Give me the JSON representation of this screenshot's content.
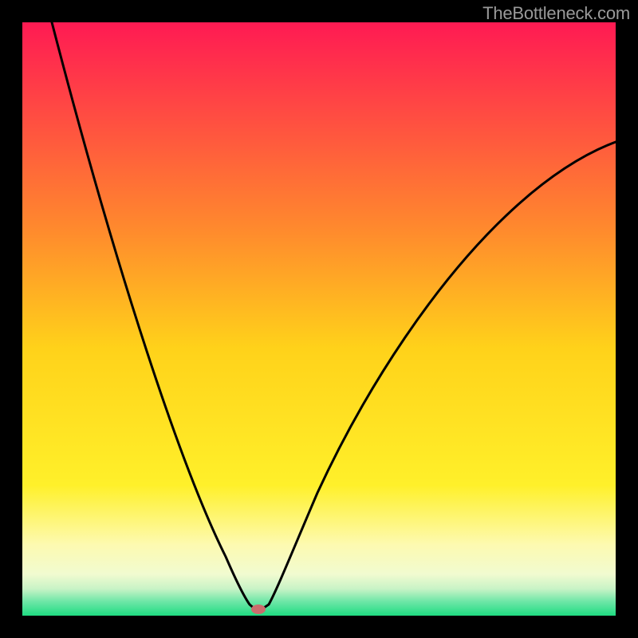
{
  "watermark": "TheBottleneck.com",
  "chart_data": {
    "type": "line",
    "title": "",
    "xlabel": "",
    "ylabel": "",
    "xlim": [
      0,
      100
    ],
    "ylim": [
      0,
      100
    ],
    "series": [
      {
        "name": "curve-left",
        "x_start": 5,
        "x_end": 38,
        "y_start": 100,
        "y_end": 1
      },
      {
        "name": "curve-right",
        "x_start": 41,
        "x_end": 100,
        "y_start": 1,
        "y_end": 80
      }
    ],
    "marker": {
      "x": 39.5,
      "y": 1,
      "color": "#cb6d6d",
      "label": "optimum"
    },
    "background_gradient": {
      "stops": [
        {
          "pos": 0.0,
          "color": "#ff1a53"
        },
        {
          "pos": 0.35,
          "color": "#ff8a2d"
        },
        {
          "pos": 0.55,
          "color": "#ffd21a"
        },
        {
          "pos": 0.78,
          "color": "#fff02a"
        },
        {
          "pos": 0.88,
          "color": "#fdfab0"
        },
        {
          "pos": 0.93,
          "color": "#f1fbd0"
        },
        {
          "pos": 0.955,
          "color": "#c8f3c6"
        },
        {
          "pos": 0.975,
          "color": "#72e7a8"
        },
        {
          "pos": 1.0,
          "color": "#1fdc82"
        }
      ]
    }
  }
}
